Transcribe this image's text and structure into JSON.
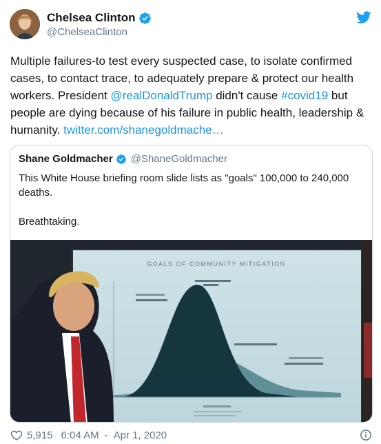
{
  "author": {
    "display_name": "Chelsea Clinton",
    "handle": "@ChelseaClinton",
    "avatar_icon": "profile-photo"
  },
  "tweet": {
    "text_before_mention": "Multiple failures-to test every suspected case, to isolate confirmed cases, to contact trace, to adequately prepare & protect our health workers. President ",
    "mention": "@realDonaldTrump",
    "text_after_mention": " didn't cause ",
    "hashtag": "#covid19",
    "text_after_hashtag": " but people are dying because of his failure in public health, leadership & humanity. ",
    "link": "twitter.com/shanegoldmache…"
  },
  "quoted": {
    "display_name": "Shane Goldmacher",
    "handle": "@ShaneGoldmacher",
    "text_line1": "This White House briefing room slide lists as \"goals\" 100,000 to 240,000 deaths.",
    "text_line2": "Breathtaking.",
    "slide_title": "GOALS OF COMMUNITY MITIGATION"
  },
  "footer": {
    "likes": "5,915",
    "time": "6:04 AM",
    "separator": "-",
    "date": "Apr 1, 2020"
  },
  "colors": {
    "link": "#1b95e0",
    "verified": "#1da1f2",
    "muted": "#657786"
  }
}
